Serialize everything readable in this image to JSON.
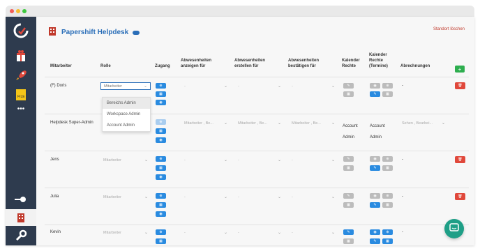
{
  "brand": {
    "name": "Papershift Helpdesk"
  },
  "header": {
    "delete_location": "Standort löschen"
  },
  "columns": {
    "employee": "Mitarbeiter",
    "role": "Rolle",
    "access": "Zugang",
    "abs_view": "Abwesenheiten anzeigen für",
    "abs_create": "Abwesenheiten erstellen für",
    "abs_confirm": "Abwesenheiten bestätigen für",
    "calendar_rights": "Kalender Rechte",
    "calendar_rights_shifts": "Kalender Rechte (Termine)",
    "billing": "Abrechnungen"
  },
  "rows": [
    {
      "name": "(F) Doris",
      "role": "Mitarbeiter",
      "abs_view": "-",
      "abs_create": "-",
      "abs_confirm": "-",
      "billing": "-"
    },
    {
      "name": "Helpdesk Super-Admin",
      "role": "",
      "abs_view": "Mitarbeiter , Be...",
      "abs_create": "Mitarbeiter , Be...",
      "abs_confirm": "Mitarbeiter , Be...",
      "cal": "Account Admin",
      "cal2": "Account Admin",
      "billing": "Sehen , Bearbei..."
    },
    {
      "name": "Jens",
      "role": "Mitarbeiter",
      "abs_view": "-",
      "abs_create": "-",
      "abs_confirm": "-",
      "billing": "-"
    },
    {
      "name": "Julia",
      "role": "Mitarbeiter",
      "abs_view": "-",
      "abs_create": "-",
      "abs_confirm": "-",
      "billing": "-"
    },
    {
      "name": "Kevin",
      "role": "Mitarbeiter",
      "abs_view": "-",
      "abs_create": "-",
      "abs_confirm": "-",
      "billing": "-"
    }
  ],
  "role_dropdown": {
    "options": [
      "Bereichs Admin",
      "Workspace Admin",
      "Account Admin"
    ]
  },
  "colors": {
    "sidebar": "#2e3b4e",
    "primary": "#2a8be0",
    "danger": "#e0483b",
    "success": "#2eae4f",
    "chat": "#1f9f87"
  }
}
